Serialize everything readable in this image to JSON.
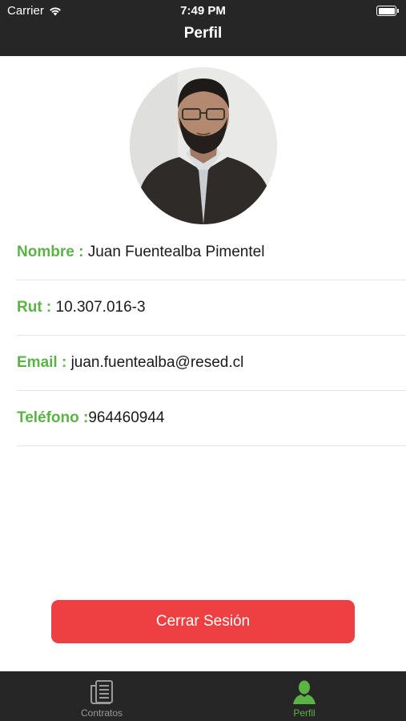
{
  "status_bar": {
    "carrier": "Carrier",
    "time": "7:49 PM"
  },
  "nav": {
    "title": "Perfil"
  },
  "profile": {
    "fields": [
      {
        "label": "Nombre : ",
        "value": "Juan Fuentealba Pimentel"
      },
      {
        "label": "Rut : ",
        "value": "10.307.016-3"
      },
      {
        "label": "Email : ",
        "value": "juan.fuentealba@resed.cl"
      },
      {
        "label": "Teléfono :",
        "value": "964460944"
      }
    ]
  },
  "actions": {
    "logout_label": "Cerrar Sesión"
  },
  "tabbar": {
    "tabs": [
      {
        "label": "Contratos",
        "icon": "document-list-icon",
        "active": false
      },
      {
        "label": "Perfil",
        "icon": "user-icon",
        "active": true
      }
    ]
  },
  "colors": {
    "accent_green": "#5bb346",
    "logout_red": "#ee3f42",
    "bar_dark": "#262626"
  }
}
